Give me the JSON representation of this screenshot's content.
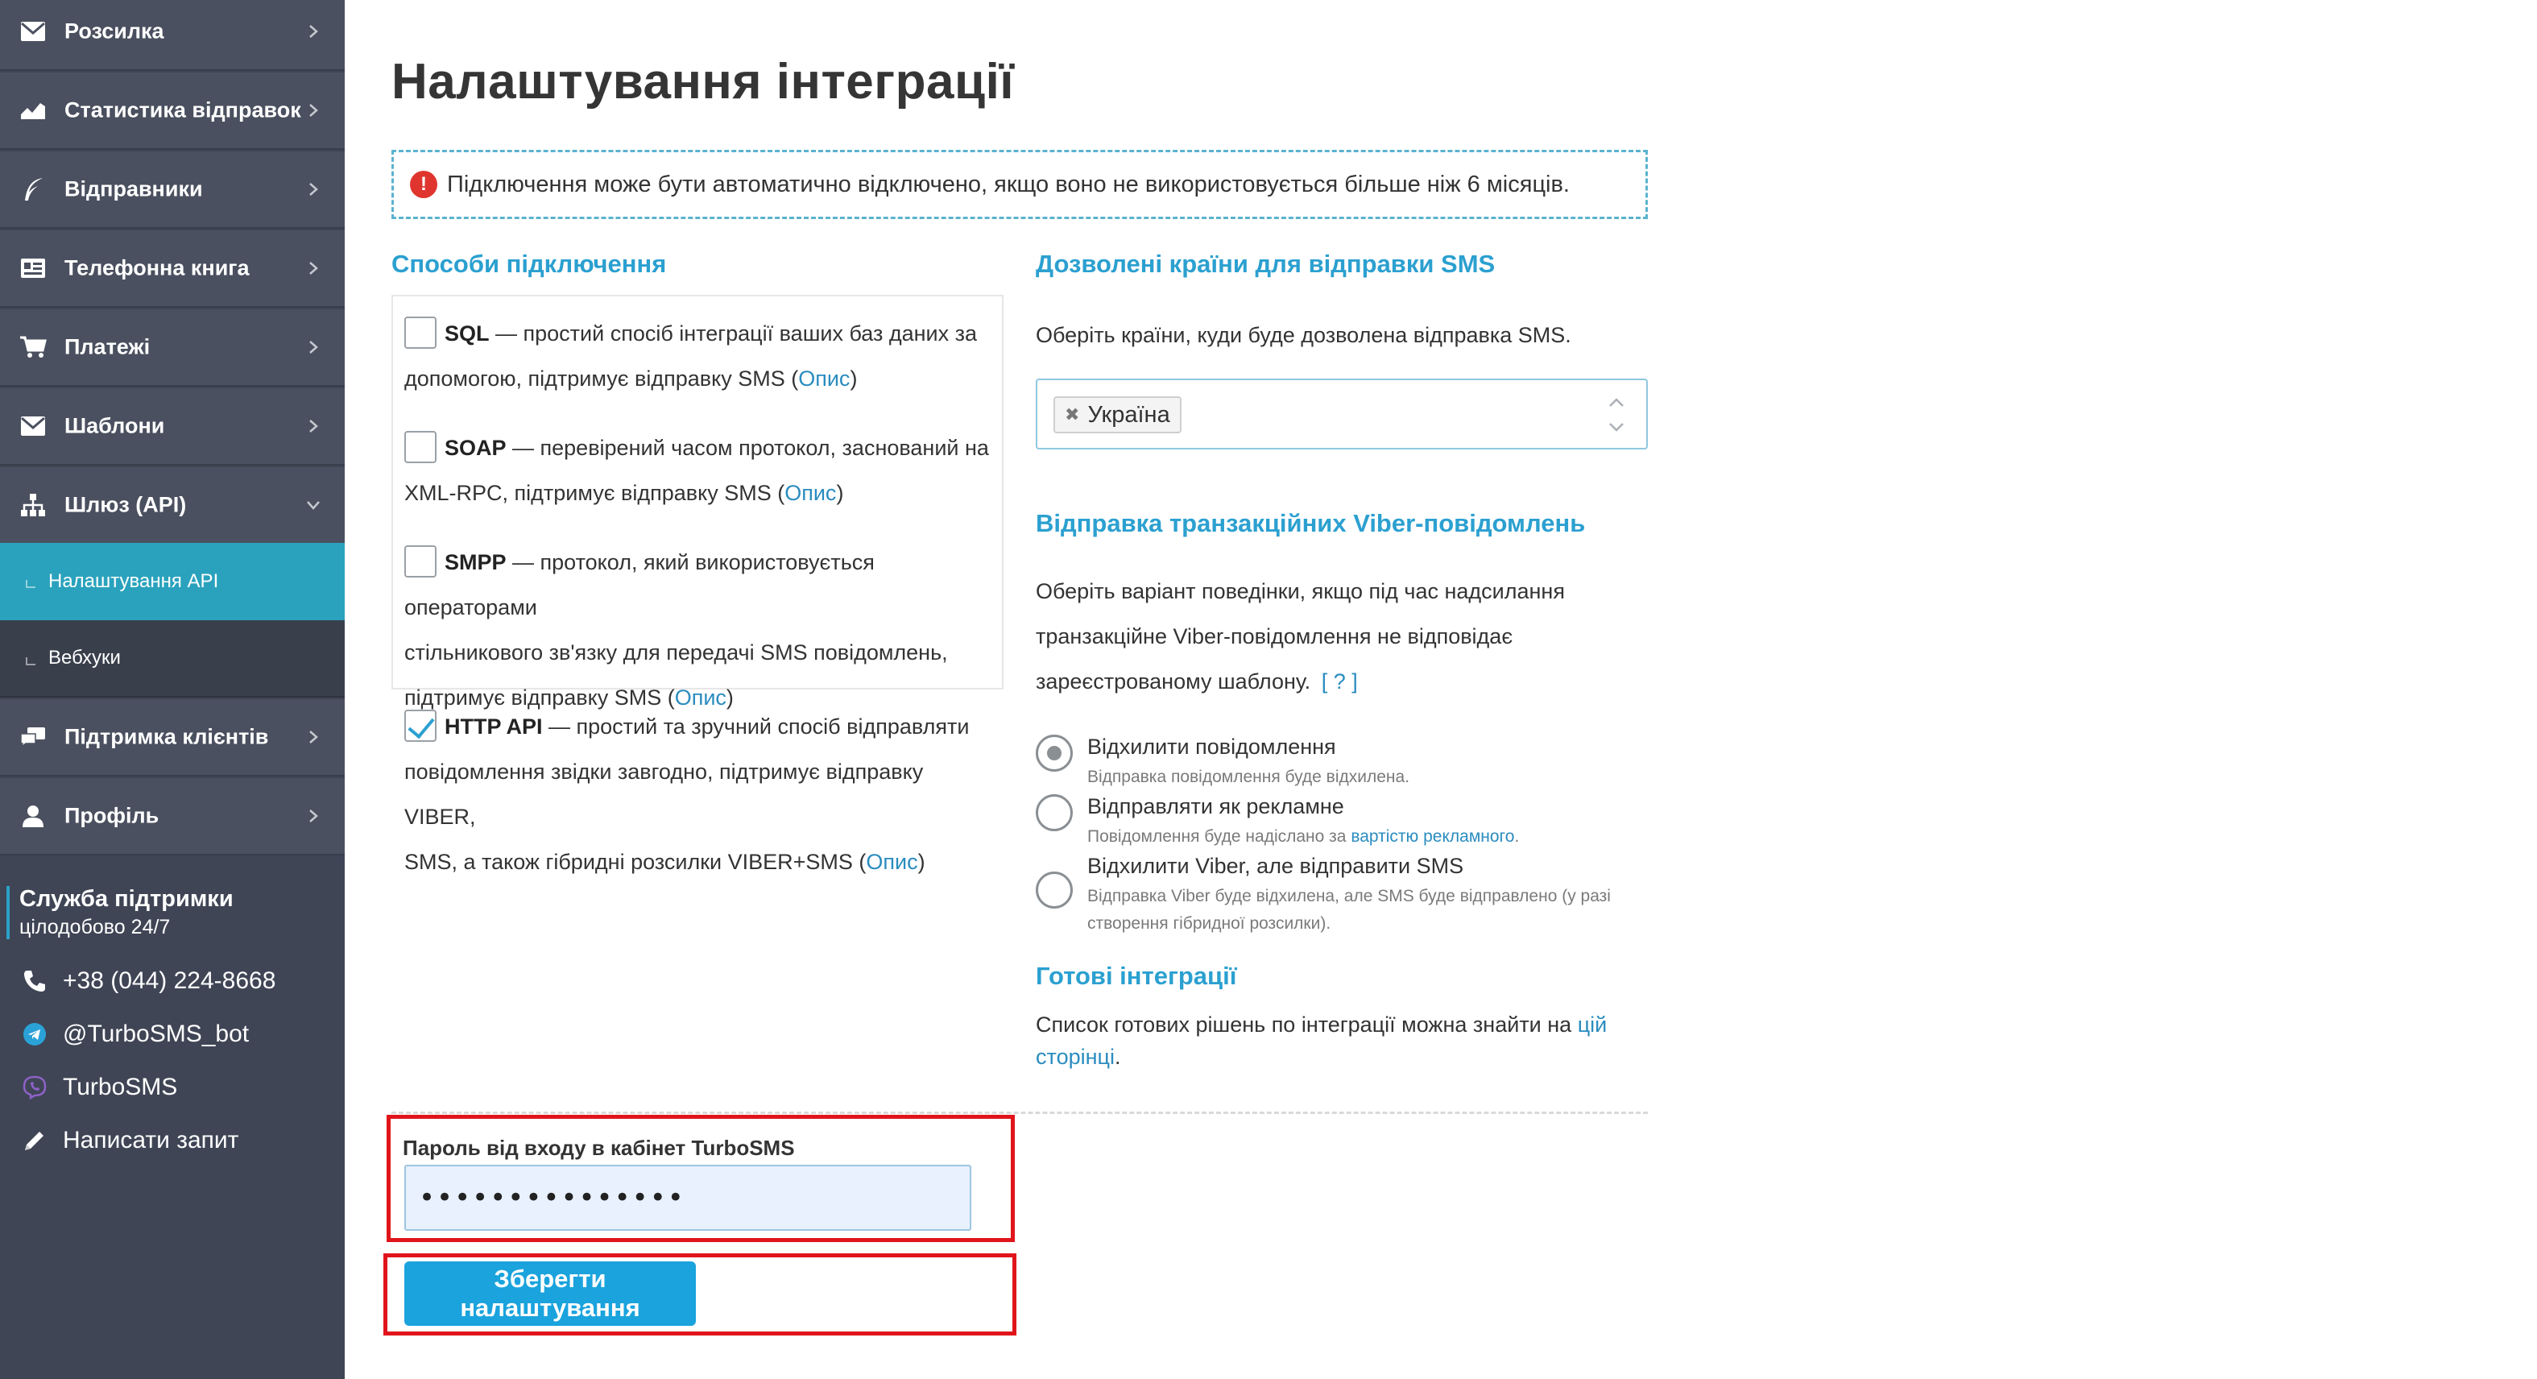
{
  "sidebar": {
    "items": [
      {
        "label": "Розсилка",
        "icon": "envelope-icon"
      },
      {
        "label": "Статистика відправок",
        "icon": "chart-icon"
      },
      {
        "label": "Відправники",
        "icon": "feather-icon"
      },
      {
        "label": "Телефонна книга",
        "icon": "address-book-icon"
      },
      {
        "label": "Платежі",
        "icon": "cart-icon"
      },
      {
        "label": "Шаблони",
        "icon": "envelope-icon"
      },
      {
        "label": "Шлюз (API)",
        "icon": "sitemap-icon",
        "expanded": true
      }
    ],
    "subitems": [
      {
        "label": "Налаштування API",
        "active": true
      },
      {
        "label": "Вебхуки",
        "active": false
      }
    ],
    "items_after": [
      {
        "label": "Підтримка клієнтів",
        "icon": "chat-icon"
      },
      {
        "label": "Профіль",
        "icon": "user-icon"
      }
    ],
    "support": {
      "title": "Служба підтримки",
      "subtitle": "цілодобово 24/7",
      "phone": "+38 (044) 224-8668",
      "telegram": "@TurboSMS_bot",
      "viber": "TurboSMS",
      "write": "Написати запит"
    }
  },
  "page": {
    "title": "Налаштування інтеграції",
    "notice": "Підключення може бути автоматично відключено, якщо воно не використовується більше ніж 6 місяців."
  },
  "connection": {
    "title": "Способи підключення",
    "options": [
      {
        "name": "SQL",
        "line1": " — простий спосіб інтеграції ваших баз даних за",
        "line2": "допомогою, підтримує відправку SMS (",
        "link": "Опис",
        "end": ")",
        "checked": false
      },
      {
        "name": "SOAP",
        "line1": " — перевірений часом протокол, заснований на",
        "line2": "XML-RPC, підтримує відправку SMS (",
        "link": "Опис",
        "end": ")",
        "checked": false
      },
      {
        "name": "SMPP",
        "line1": " — протокол, який використовується операторами",
        "line2": "стільникового зв'язку для передачі SMS повідомлень,",
        "line3": "підтримує відправку SMS (",
        "link": "Опис",
        "end": ")",
        "checked": false
      },
      {
        "name": "HTTP API",
        "line1": " — простий та зручний спосіб відправляти",
        "line2": "повідомлення звідки завгодно, підтримує відправку VIBER,",
        "line3": "SMS, а також гібридні розсилки VIBER+SMS (",
        "link": "Опис",
        "end": ")",
        "checked": true
      }
    ]
  },
  "countries": {
    "title": "Дозволені країни для відправки SMS",
    "description": "Оберіть країни, куди буде дозволена відправка SMS.",
    "selected": "Україна"
  },
  "viber": {
    "title": "Відправка транзакційних Viber-повідомлень",
    "desc1": "Оберіть варіант поведінки, якщо під час надсилання",
    "desc2": "транзакційне Viber-повідомлення не відповідає",
    "desc3": "зареєстрованому шаблону.",
    "help": "[ ? ]",
    "options": [
      {
        "label": "Відхилити повідомлення",
        "desc": "Відправка повідомлення буде відхилена.",
        "selected": true
      },
      {
        "label": "Відправляти як рекламне",
        "desc": "Повідомлення буде надіслано за ",
        "desc_link": "вартістю рекламного",
        "desc_end": ".",
        "selected": false
      },
      {
        "label": "Відхилити Viber, але відправити SMS",
        "desc": "Відправка Viber буде відхилена, але SMS буде відправлено (у разі створення гібридної розсилки).",
        "selected": false
      }
    ]
  },
  "ready": {
    "title": "Готові інтеграції",
    "text": "Список готових рішень по інтеграції можна знайти на ",
    "link": "цій сторінці",
    "end": "."
  },
  "form": {
    "password_label": "Пароль від входу в кабінет TurboSMS",
    "password_value": "•••••••••••••••",
    "save_label": "Зберегти налаштування"
  }
}
